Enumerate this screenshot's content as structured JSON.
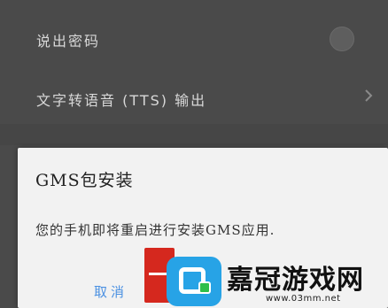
{
  "settings": {
    "items": [
      {
        "label": "说出密码",
        "control": "toggle"
      },
      {
        "label": "文字转语音 (TTS) 输出",
        "control": "chevron-right-icon"
      }
    ]
  },
  "dialog": {
    "title": "GMS包安装",
    "message": "您的手机即将重启进行安装GMS应用.",
    "cancel_label": "取消"
  },
  "watermark": {
    "text": "嘉冠游戏网",
    "url": "www.03mm.net"
  }
}
